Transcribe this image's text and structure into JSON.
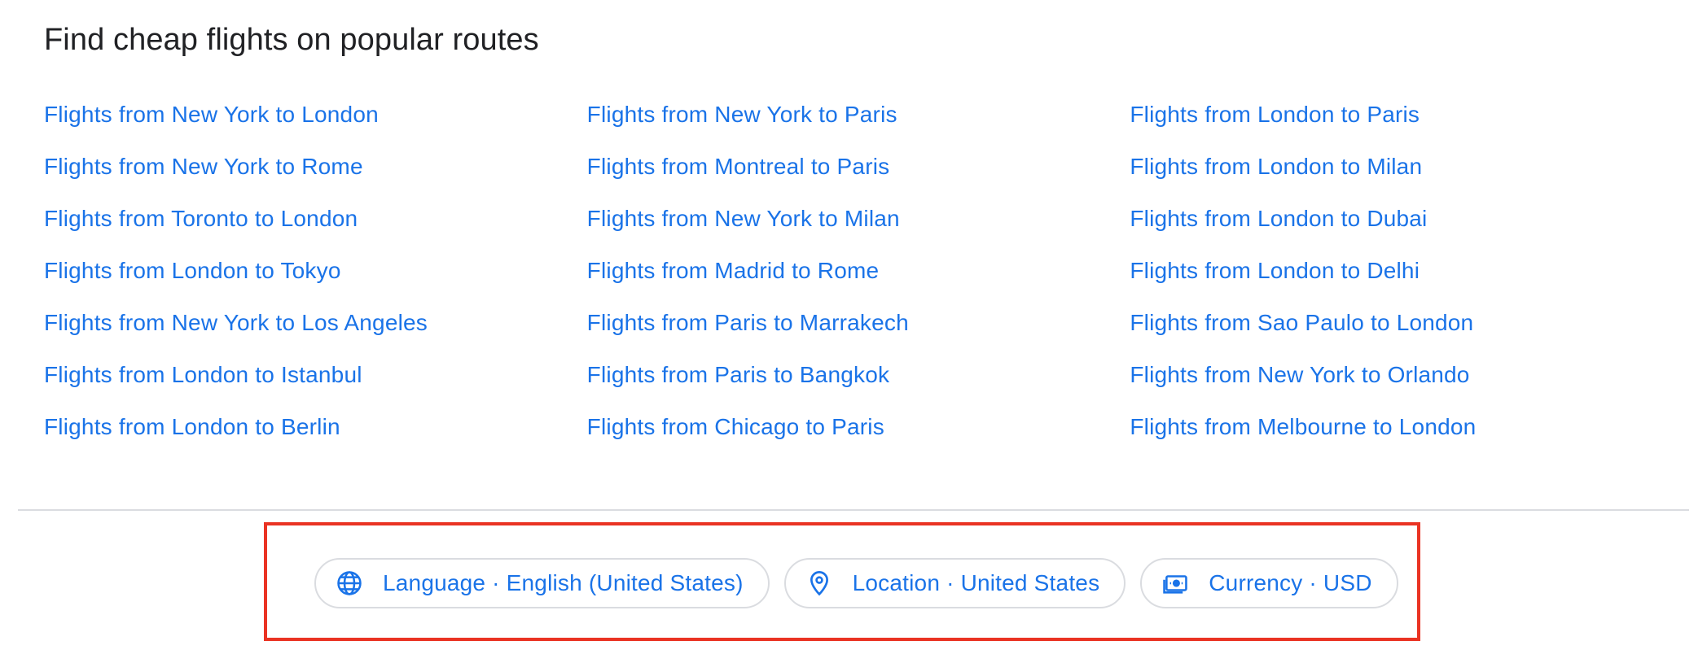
{
  "section": {
    "title": "Find cheap flights on popular routes"
  },
  "routes": {
    "columns": [
      [
        "Flights from New York to London",
        "Flights from New York to Rome",
        "Flights from Toronto to London",
        "Flights from London to Tokyo",
        "Flights from New York to Los Angeles",
        "Flights from London to Istanbul",
        "Flights from London to Berlin"
      ],
      [
        "Flights from New York to Paris",
        "Flights from Montreal to Paris",
        "Flights from New York to Milan",
        "Flights from Madrid to Rome",
        "Flights from Paris to Marrakech",
        "Flights from Paris to Bangkok",
        "Flights from Chicago to Paris"
      ],
      [
        "Flights from London to Paris",
        "Flights from London to Milan",
        "Flights from London to Dubai",
        "Flights from London to Delhi",
        "Flights from Sao Paulo to London",
        "Flights from New York to Orlando",
        "Flights from Melbourne to London"
      ]
    ]
  },
  "settings": {
    "language": {
      "label": "Language · English (United States)",
      "icon": "globe-icon"
    },
    "location": {
      "label": "Location · United States",
      "icon": "location-pin-icon"
    },
    "currency": {
      "label": "Currency · USD",
      "icon": "currency-note-icon"
    }
  },
  "colors": {
    "link": "#1a73e8",
    "heading": "#202124",
    "divider": "#dadce0",
    "highlight": "#ea3323"
  }
}
